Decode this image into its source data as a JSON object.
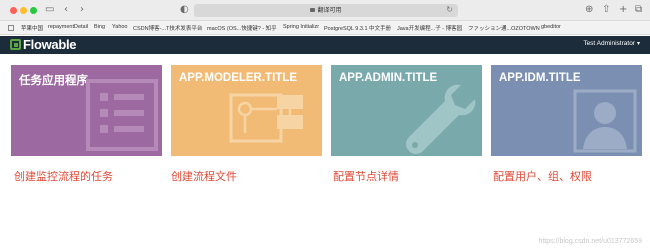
{
  "browser": {
    "address": "翻译可用",
    "bookmarks": [
      "苹果中国",
      "repaymentDetail",
      "Bing",
      "Yahoo",
      "CSDN博客-...T技术发表平台",
      "macOS (OS...快捷键? - 知乎",
      "Spring Initializr",
      "PostgreSQL 9.3.1 中文手册",
      "Java开发编程...子 - 博客园",
      "ファッション通...OZOTOWN",
      "gbeditor"
    ]
  },
  "header": {
    "logo_text": "Flowable",
    "user_name": "Test Administrator",
    "caret": "▾"
  },
  "tiles": [
    {
      "title": "任务应用程序",
      "link": "创建监控流程的任务",
      "icon": "task-list-icon",
      "color": "#9c6aa0"
    },
    {
      "title": "APP.MODELER.TITLE",
      "link": "创建流程文件",
      "icon": "process-diagram-icon",
      "color": "#f1bb76"
    },
    {
      "title": "APP.ADMIN.TITLE",
      "link": "配置节点详情",
      "icon": "wrench-icon",
      "color": "#79a9ab"
    },
    {
      "title": "APP.IDM.TITLE",
      "link": "配置用户、组、权限",
      "icon": "user-icon",
      "color": "#7a8fb1"
    }
  ],
  "watermark": "https://blog.csdn.net/u013772659"
}
